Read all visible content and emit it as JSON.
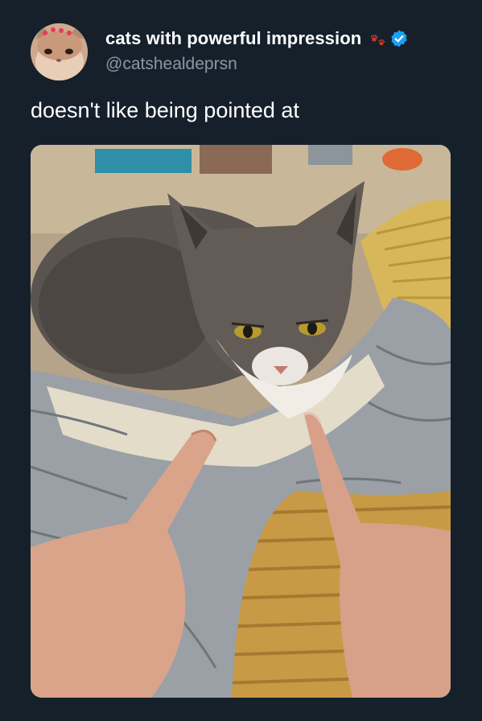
{
  "tweet": {
    "author": {
      "display_name": "cats with powerful impression",
      "handle": "@catshealdeprsn",
      "avatar_icon": "cat-face-avatar",
      "badges": [
        "paw-prints-icon",
        "verified-badge-icon"
      ]
    },
    "text": "doesn't like being pointed at",
    "media": {
      "kind": "photo",
      "icon": "cat-on-blanket-photo"
    }
  },
  "colors": {
    "background": "#15202b",
    "text_primary": "#ffffff",
    "text_secondary": "#8899a6",
    "verified": "#1da1f2",
    "paw": "#c0392b"
  }
}
